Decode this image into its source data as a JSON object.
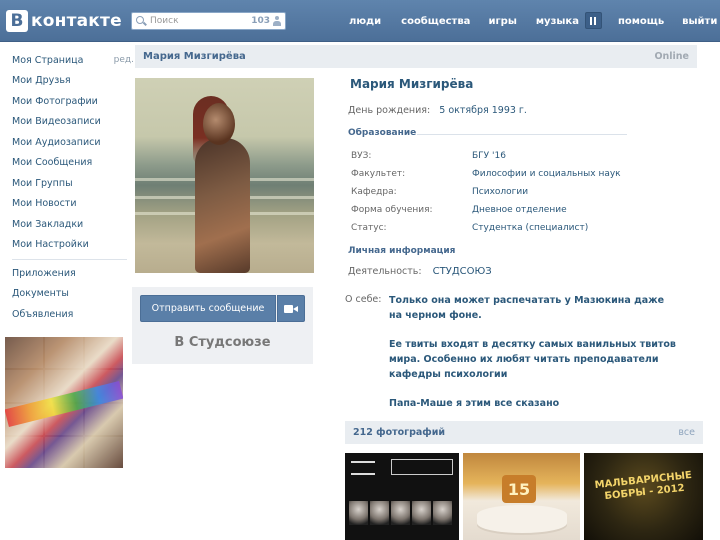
{
  "header": {
    "logo_letter": "В",
    "logo_text": "контакте",
    "search_placeholder": "Поиск",
    "search_count": "103",
    "nav": [
      "люди",
      "сообщества",
      "игры",
      "музыка",
      "помощь",
      "выйти"
    ]
  },
  "sidebar": {
    "items": [
      "Моя Страница",
      "Мои Друзья",
      "Мои Фотографии",
      "Мои Видеозаписи",
      "Мои Аудиозаписи",
      "Мои Сообщения",
      "Мои Группы",
      "Мои Новости",
      "Мои Закладки",
      "Мои Настройки"
    ],
    "edit_label": "ред.",
    "extra_items": [
      "Приложения",
      "Документы",
      "Объявления"
    ]
  },
  "profile": {
    "header_name": "Мария Мизгирёва",
    "status": "Online",
    "full_name": "Мария Мизгирёва",
    "birthday_label": "День рождения:",
    "birthday_value": "5 октября 1993 г.",
    "education_title": "Образование",
    "education": [
      {
        "label": "ВУЗ:",
        "value": "БГУ '16"
      },
      {
        "label": "Факультет:",
        "value": "Философии и социальных наук"
      },
      {
        "label": "Кафедра:",
        "value": "Психологии"
      },
      {
        "label": "Форма обучения:",
        "value": "Дневное отделение"
      },
      {
        "label": "Статус:",
        "value": "Студентка (специалист)"
      }
    ],
    "personal_title": "Личная информация",
    "activity_label": "Деятельность:",
    "activity_value": "СТУДСОЮЗ",
    "about_label": "О себе:",
    "about_paragraphs": [
      "Только она может распечатать у Мазюкина даже на черном фоне.",
      "Ее твиты входят в десятку самых ванильных твитов мира. Особенно их любят читать преподаватели кафедры психологии",
      "Папа-Маше я этим все сказано"
    ]
  },
  "actions": {
    "send_message": "Отправить сообщение",
    "group_name": "В Студсоюзе"
  },
  "photos": {
    "title": "212 фотографий",
    "all_link": "все",
    "photo3_text": "МАЛЬВАРИСНЫЕ БОБРЫ - 2012"
  }
}
